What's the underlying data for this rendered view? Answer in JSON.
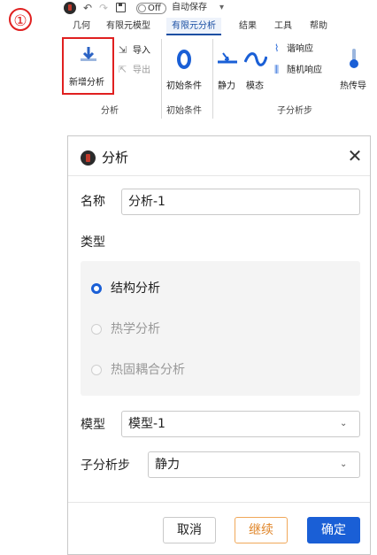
{
  "step": {
    "number": "①"
  },
  "quick_access": {
    "toggle_label": "Off",
    "autosave_label": "自动保存",
    "dropdown_glyph": "▾"
  },
  "menu_tabs": [
    {
      "label": "几何"
    },
    {
      "label": "有限元模型"
    },
    {
      "label": "有限元分析",
      "active": true
    },
    {
      "label": "结果"
    },
    {
      "label": "工具"
    },
    {
      "label": "帮助"
    }
  ],
  "ribbon": {
    "new_analysis_label": "新增分析",
    "import_label": "导入",
    "export_label": "导出",
    "initial_conditions_label": "初始条件",
    "static_label": "静力",
    "modal_label": "模态",
    "harmonic_label": "谐响应",
    "random_label": "随机响应",
    "heat_label": "热传导",
    "group_analysis": "分析",
    "group_initial": "初始条件",
    "group_substep": "子分析步"
  },
  "dialog": {
    "title": "分析",
    "name_label": "名称",
    "name_value": "分析-1",
    "type_label": "类型",
    "types": [
      {
        "label": "结构分析",
        "selected": true,
        "enabled": true
      },
      {
        "label": "热学分析",
        "selected": false,
        "enabled": false
      },
      {
        "label": "热固耦合分析",
        "selected": false,
        "enabled": false
      }
    ],
    "model_label": "模型",
    "model_value": "模型-1",
    "substep_label": "子分析步",
    "substep_value": "静力",
    "cancel_label": "取消",
    "continue_label": "继续",
    "ok_label": "确定",
    "close_glyph": "✕"
  },
  "colors": {
    "accent": "#1a5fd6",
    "highlight_red": "#e02020",
    "continue_orange": "#e0862a",
    "active_tab": "#1a4fa3"
  },
  "icons": [
    "logo-icon",
    "undo-icon",
    "redo-icon",
    "save-icon",
    "download-arrow-icon",
    "import-icon",
    "export-icon",
    "initial-condition-icon",
    "static-icon",
    "modal-wave-icon",
    "harmonic-icon",
    "random-icon",
    "thermometer-icon",
    "close-icon",
    "chevron-down-icon"
  ]
}
